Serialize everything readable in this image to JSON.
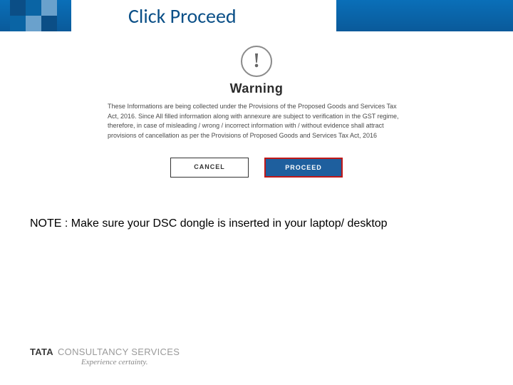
{
  "header": {
    "title": "Click Proceed"
  },
  "dialog": {
    "icon_glyph": "!",
    "heading": "Warning",
    "body": "These Informations are being collected under the Provisions of the Proposed Goods and Services Tax Act, 2016. Since All filled information along with annexure are subject to verification in the GST regime, therefore, in case of misleading / wrong / incorrect information with / without evidence shall attract provisions of cancellation as per the Provisions of Proposed Goods and Services Tax Act, 2016",
    "cancel_label": "CANCEL",
    "proceed_label": "PROCEED"
  },
  "note": "NOTE : Make sure your DSC dongle is inserted in your laptop/ desktop",
  "footer": {
    "brand_bold": "TATA",
    "brand_light": "CONSULTANCY SERVICES",
    "tagline": "Experience certainty."
  }
}
